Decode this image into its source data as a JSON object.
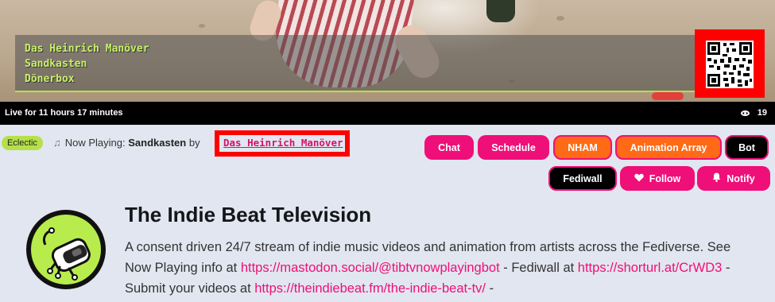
{
  "overlay": {
    "artist": "Das Heinrich Manöver",
    "song": "Sandkasten",
    "album": "Dönerbox"
  },
  "live": {
    "status": "Live for 11 hours 17 minutes",
    "viewers": "19"
  },
  "now_playing": {
    "tag": "Eclectic",
    "label": "Now Playing:",
    "song": "Sandkasten",
    "by": "by",
    "artist": "Das Heinrich Manöver"
  },
  "buttons": {
    "chat": "Chat",
    "schedule": "Schedule",
    "nham": "NHAM",
    "animation_array": "Animation Array",
    "bot": "Bot",
    "fediwall": "Fediwall",
    "follow": "Follow",
    "notify": "Notify"
  },
  "profile": {
    "title": "The Indie Beat Television",
    "desc_1": "A consent driven 24/7 stream of indie music videos and animation from artists across the Fediverse. See Now Playing info at ",
    "link_1": "https://mastodon.social/@tibtvnowplayingbot",
    "desc_2": " - Fediwall at ",
    "link_2": "https://shorturl.at/CrWD3",
    "desc_3": " - Submit your videos at ",
    "link_3": "https://theindiebeat.fm/the-indie-beat-tv/",
    "desc_4": " -"
  },
  "colors": {
    "accent_pink": "#ef0f79",
    "accent_orange": "#ff6a16",
    "tag_green": "#b5e04a",
    "overlay_text": "#c9f06a"
  },
  "icons": {
    "viewers": "eye-icon",
    "note": "music-note-icon",
    "follow": "heart-icon",
    "notify": "bell-icon"
  }
}
